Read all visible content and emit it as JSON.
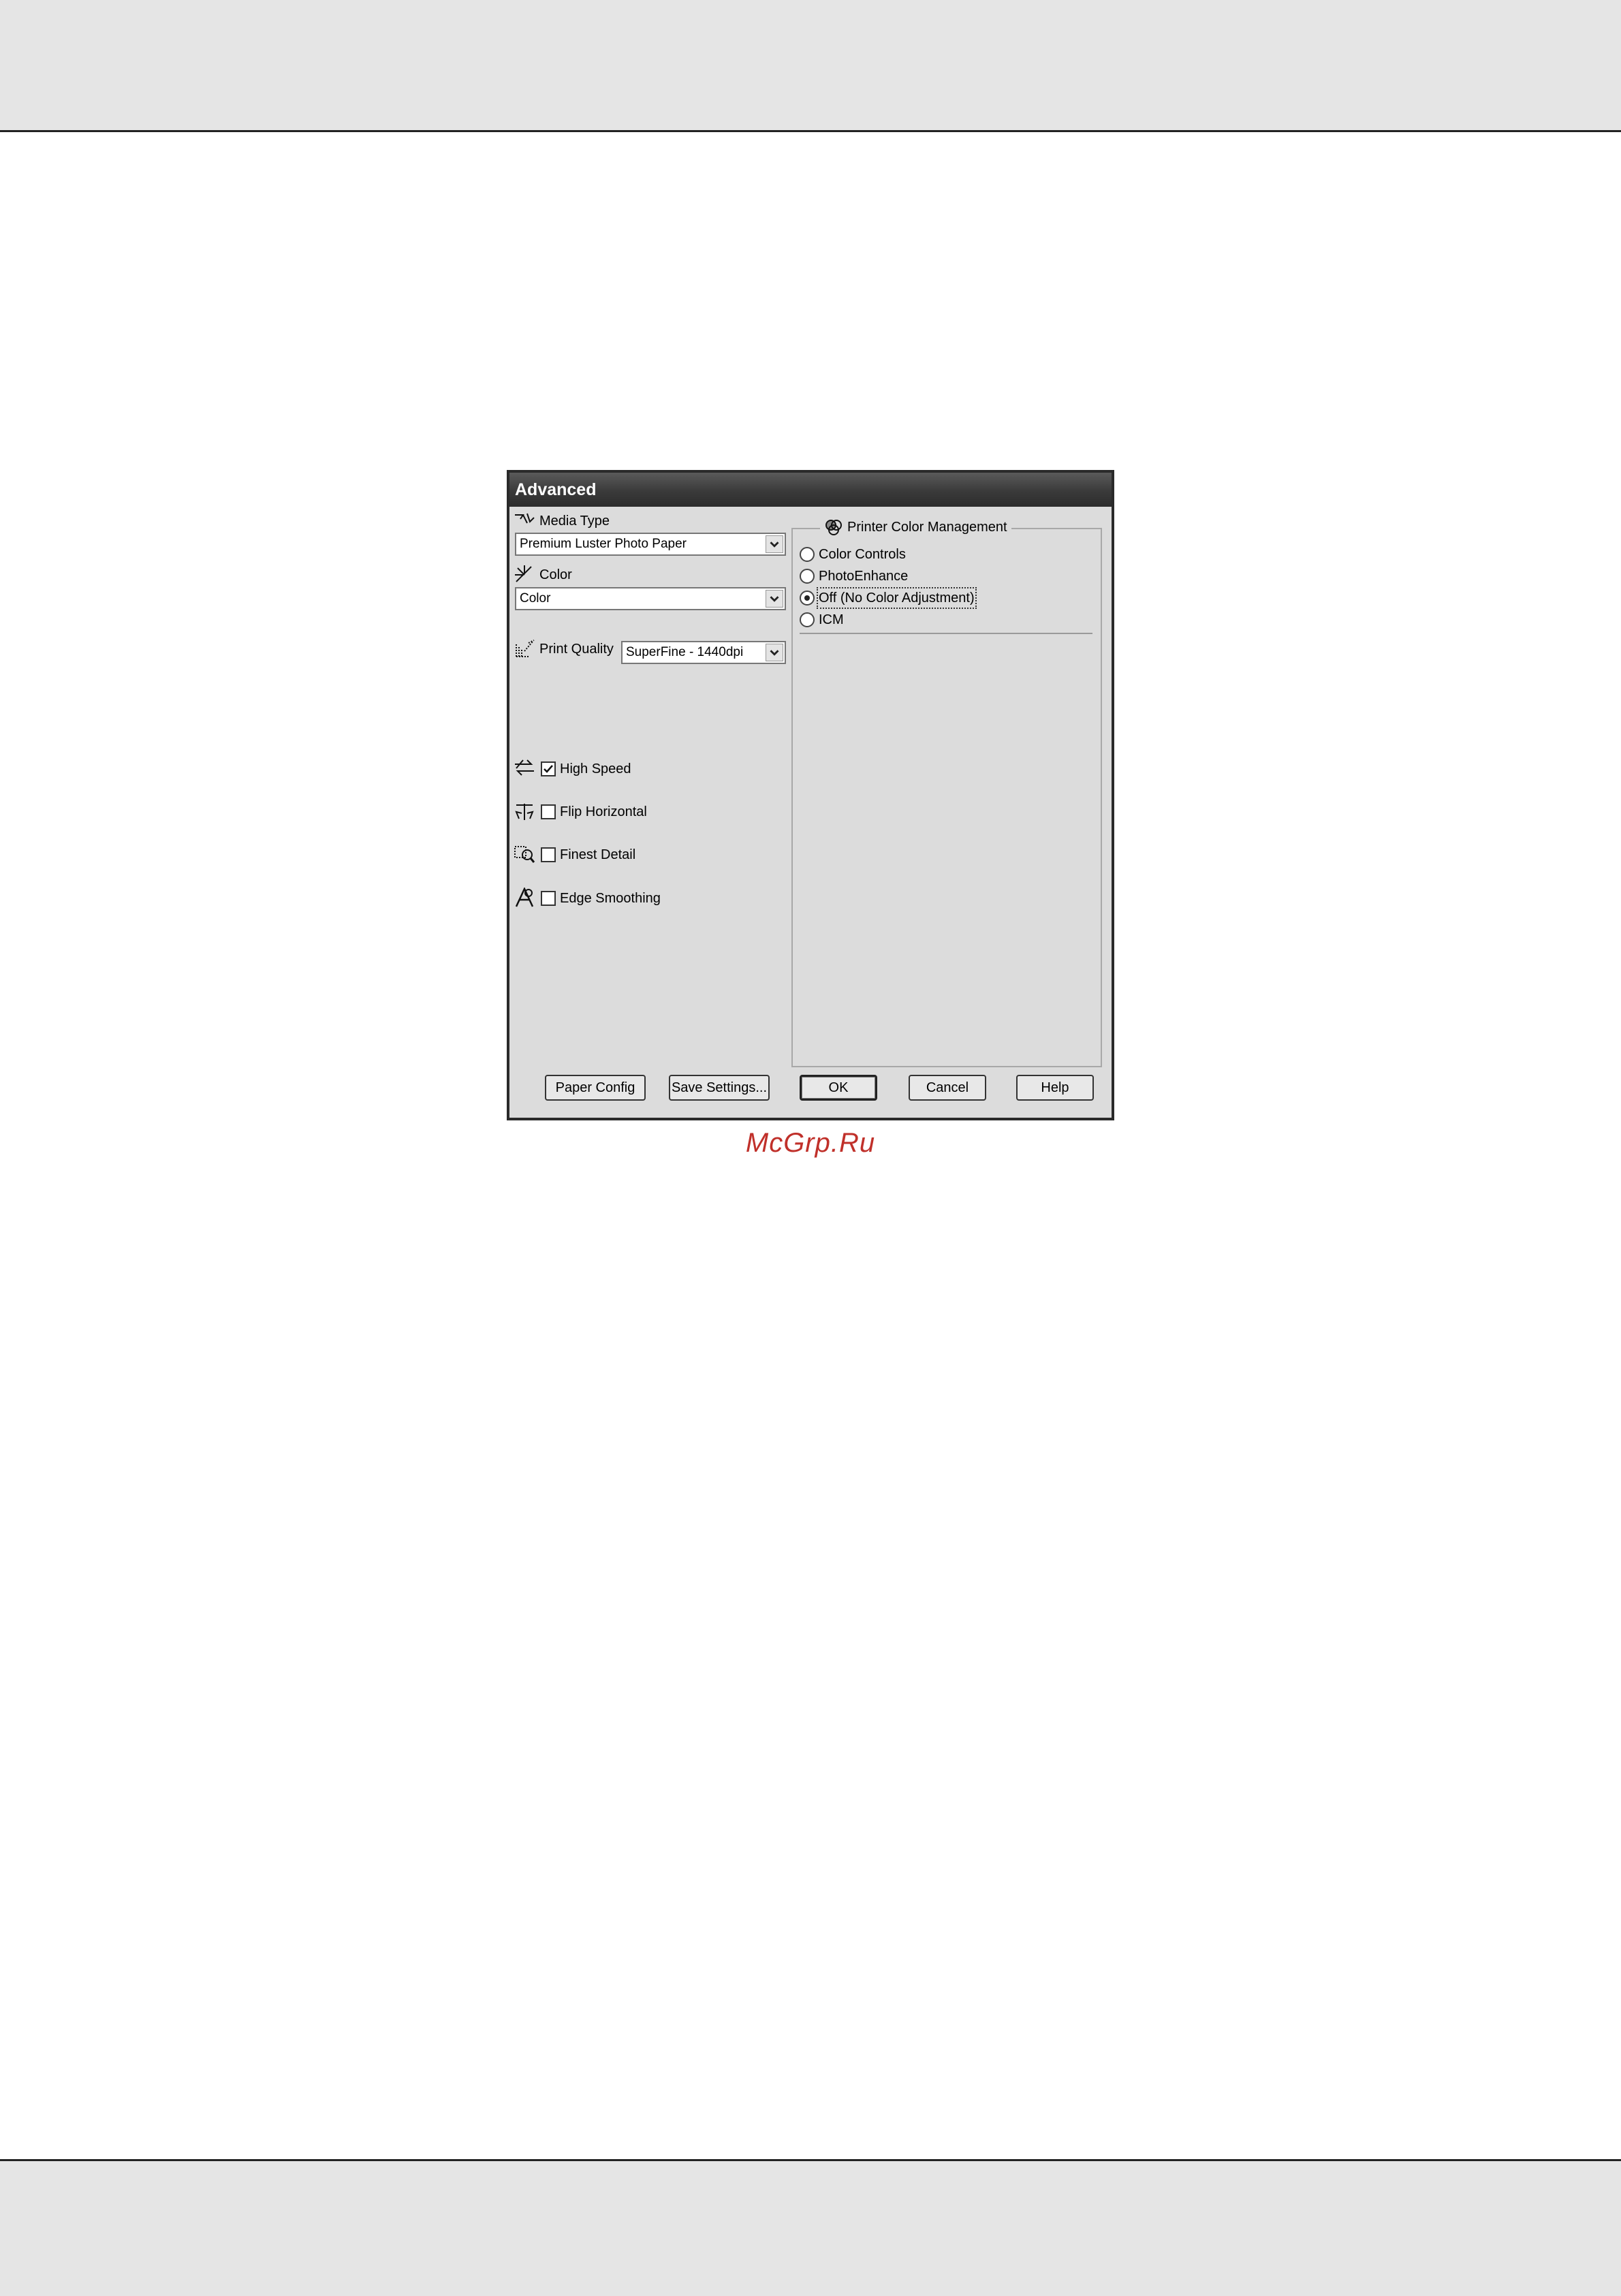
{
  "dialog": {
    "title": "Advanced",
    "media_type": {
      "label": "Media Type",
      "value": "Premium Luster Photo Paper"
    },
    "color": {
      "label": "Color",
      "value": "Color"
    },
    "print_quality": {
      "label": "Print Quality",
      "value": "SuperFine - 1440dpi"
    },
    "options": [
      {
        "label": "High Speed",
        "checked": true
      },
      {
        "label": "Flip Horizontal",
        "checked": false
      },
      {
        "label": "Finest Detail",
        "checked": false
      },
      {
        "label": "Edge Smoothing",
        "checked": false
      }
    ],
    "color_management": {
      "title": "Printer Color Management",
      "options": [
        "Color Controls",
        "PhotoEnhance",
        "Off (No Color Adjustment)",
        "ICM"
      ],
      "selected": "Off (No Color Adjustment)"
    },
    "buttons": {
      "paper_config": "Paper Config",
      "save_settings": "Save Settings...",
      "ok": "OK",
      "cancel": "Cancel",
      "help": "Help"
    }
  },
  "watermark": "McGrp.Ru",
  "icons": [
    "media-type-icon",
    "color-icon",
    "print-quality-icon",
    "high-speed-icon",
    "flip-horizontal-icon",
    "finest-detail-icon",
    "edge-smoothing-icon",
    "color-management-icon",
    "dropdown-arrow-icon",
    "checkmark-icon"
  ]
}
